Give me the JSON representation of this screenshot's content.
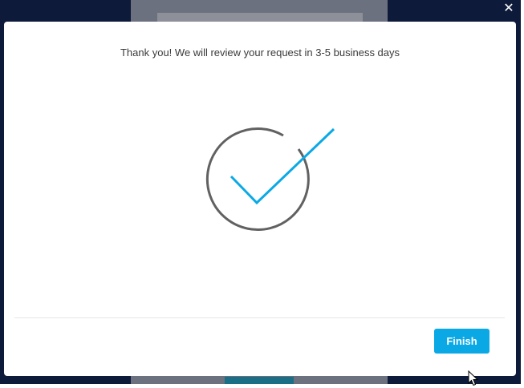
{
  "window": {
    "close_icon": "close-icon",
    "close_glyph": "✕"
  },
  "modal": {
    "message": "Thank you! We will review your request in 3-5 business days",
    "icon": "checkmark-icon",
    "finish_label": "Finish"
  },
  "colors": {
    "accent": "#0aa9e6",
    "circle": "#616161",
    "backdrop": "#0d1a3a"
  }
}
